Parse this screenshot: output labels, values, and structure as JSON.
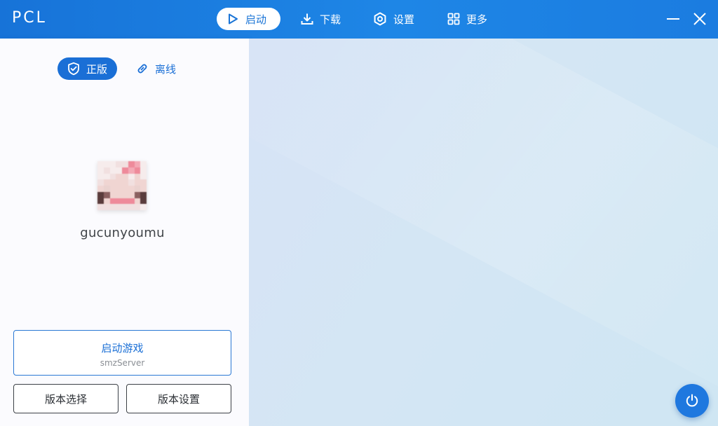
{
  "app": {
    "logo": "PCL"
  },
  "nav": {
    "items": [
      {
        "id": "launch",
        "label": "启动",
        "icon": "play-icon",
        "active": true
      },
      {
        "id": "download",
        "label": "下载",
        "icon": "download-icon",
        "active": false
      },
      {
        "id": "settings",
        "label": "设置",
        "icon": "gear-icon",
        "active": false
      },
      {
        "id": "more",
        "label": "更多",
        "icon": "grid-icon",
        "active": false
      }
    ]
  },
  "window_controls": {
    "minimize_icon": "minimize-icon",
    "close_icon": "close-icon"
  },
  "login": {
    "tabs": [
      {
        "label": "正版",
        "icon": "shield-check-icon",
        "active": true
      },
      {
        "label": "离线",
        "icon": "link-icon",
        "active": false
      }
    ],
    "username": "gucunyoumu",
    "avatar_icon": "player-skin-avatar"
  },
  "actions": {
    "launch_title": "启动游戏",
    "launch_subtitle": "smzServer",
    "version_select": "版本选择",
    "version_settings": "版本设置",
    "power_icon": "power-icon"
  },
  "colors": {
    "accent": "#1a6fd6",
    "titlebar": "#1b7ce0"
  }
}
